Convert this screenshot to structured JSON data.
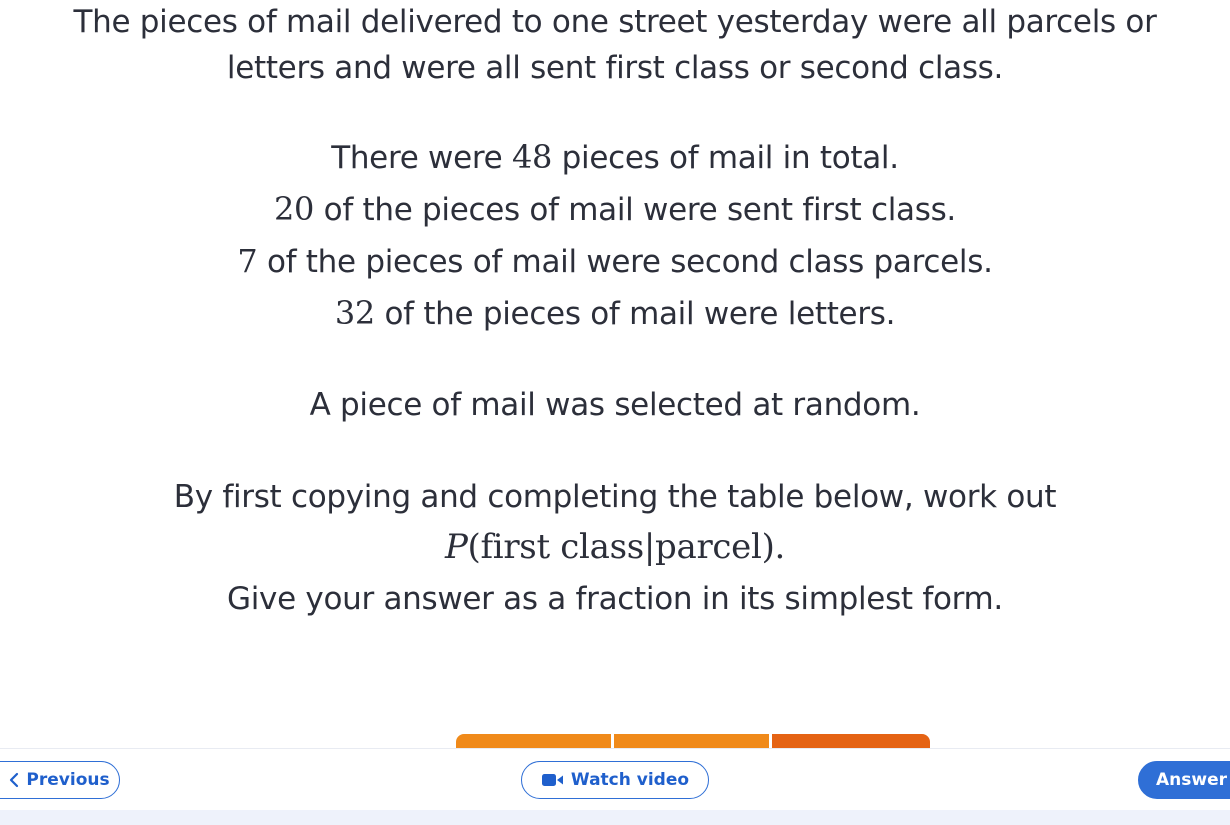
{
  "question": {
    "intro_line1": "The pieces of mail delivered to one street yesterday were all parcels or",
    "intro_line2": "letters and were all sent first class or second class.",
    "facts": [
      {
        "number": "48",
        "before": "There were ",
        "after": " pieces of mail in total."
      },
      {
        "number": "20",
        "before": "",
        "after": " of the pieces of mail were sent first class."
      },
      {
        "number": "7",
        "before": "",
        "after": " of the pieces of mail were second class parcels."
      },
      {
        "number": "32",
        "before": "",
        "after": " of the pieces of mail were letters."
      }
    ],
    "selection": "A piece of mail was selected at random.",
    "instruction": "By first copying and completing the table below, work out",
    "probability": {
      "P": "P",
      "expr": "(first class|parcel)."
    },
    "answer_form": "Give your answer as a fraction in its simplest form."
  },
  "nav": {
    "previous_label": "Previous",
    "watch_label": "Watch video",
    "answer_label": "Answer"
  },
  "colors": {
    "accent_blue": "#2f6fd6",
    "table_orange": "#f08a1a",
    "table_orange_dark": "#e56314",
    "text": "#2c2f3a"
  },
  "icons": [
    "chevron-left-icon",
    "video-camera-icon"
  ]
}
